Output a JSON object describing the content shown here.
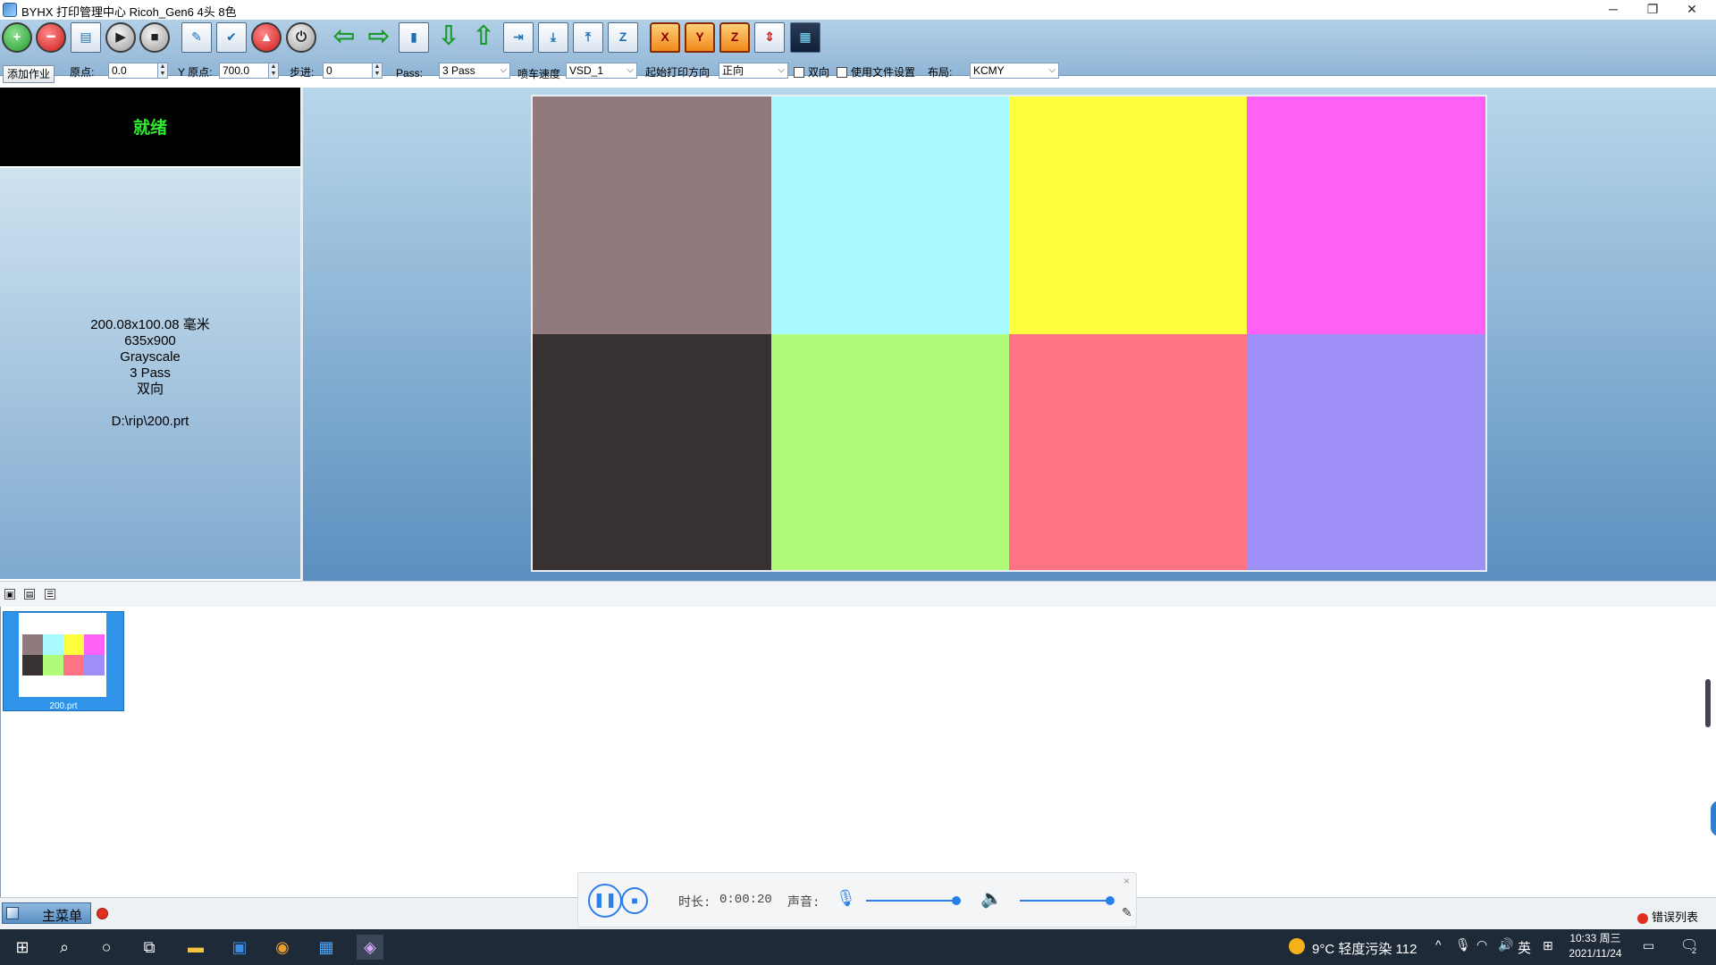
{
  "window": {
    "title": "BYHX  打印管理中心 Ricoh_Gen6 4头 8色",
    "minimize": "─",
    "restore": "❐",
    "close": "✕"
  },
  "toolbar_icons": [
    "add-job-icon",
    "delete-icon",
    "printer-icon",
    "play-icon",
    "stop-icon",
    "clean-icon",
    "check-icon",
    "emergency-stop-icon",
    "power-icon",
    "move-left-icon",
    "move-right-icon",
    "carriage-icon",
    "move-down-icon",
    "move-up-icon",
    "feed-icon",
    "media-down-icon",
    "media-up-icon",
    "z-axis-icon",
    "home-x-icon",
    "home-y-icon",
    "home-z-icon",
    "measure-icon",
    "settings-grid-icon"
  ],
  "params": {
    "add_job": "添加作业",
    "x_origin_label": "原点:",
    "x_origin_value": "0.0",
    "y_origin_label": "Y 原点:",
    "y_origin_value": "700.0",
    "step_label": "步进:",
    "step_value": "0",
    "pass_label": "Pass:",
    "pass_value": "3 Pass",
    "speed_label": "喷车速度",
    "speed_value": "VSD_1",
    "direction_label": "起始打印方向",
    "direction_value": "正向",
    "bidirectional_label": "双向",
    "use_file_settings_label": "使用文件设置",
    "layout_label": "布局:",
    "layout_value": "KCMY"
  },
  "status": {
    "text": "就绪",
    "color": "#2ee92e"
  },
  "job_info": {
    "size": "200.08x100.08 毫米",
    "resolution": "635x900",
    "color_mode": "Grayscale",
    "pass": "3 Pass",
    "direction": "双向",
    "path": "D:\\rip\\200.prt"
  },
  "preview_swatches": [
    "#917a7c",
    "#a8faff",
    "#ffff40",
    "#ff60f6",
    "#373131",
    "#b0fb7a",
    "#ff7385",
    "#9d8ff5"
  ],
  "job_list": {
    "thumb_label": "200.prt"
  },
  "recorder": {
    "duration_label": "时长:",
    "duration_value": "0:00:20",
    "volume_label": "声音:",
    "close": "×"
  },
  "bottom": {
    "main_menu": "主菜单",
    "error_list": "错误列表"
  },
  "taskbar": {
    "weather": "9°C  轻度污染 112",
    "ime": "英",
    "time": "10:33 周三",
    "date": "2021/11/24",
    "notification_badge": "2"
  }
}
